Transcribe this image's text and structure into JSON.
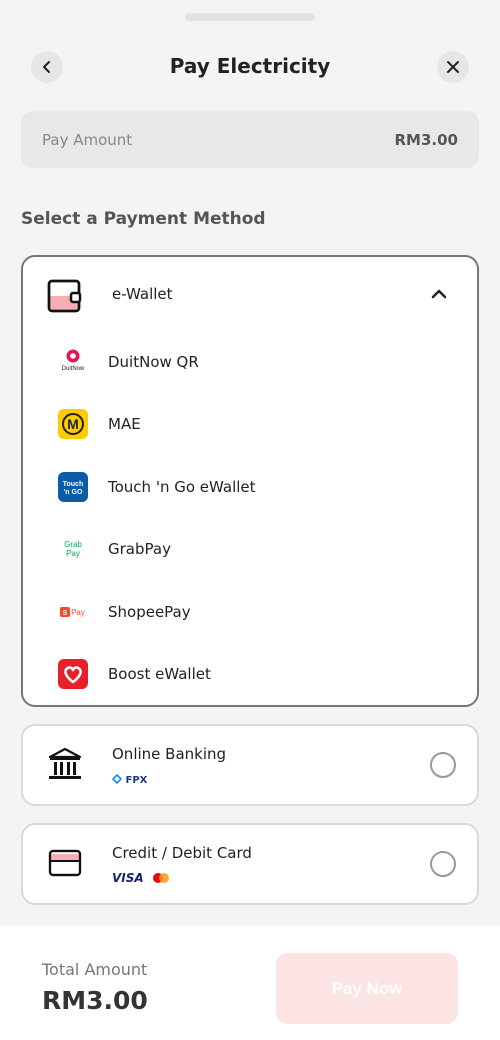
{
  "header": {
    "title": "Pay Electricity"
  },
  "pay_amount": {
    "label": "Pay Amount",
    "value": "RM3.00"
  },
  "section_title": "Select a Payment Method",
  "ewallet": {
    "label": "e-Wallet",
    "items": [
      {
        "name": "DuitNow QR",
        "logo_text": "DuitNow"
      },
      {
        "name": "MAE",
        "logo_text": "M"
      },
      {
        "name": "Touch 'n Go eWallet",
        "logo_text": "Touch 'n GO"
      },
      {
        "name": "GrabPay",
        "logo_text": "Grab Pay"
      },
      {
        "name": "ShopeePay",
        "logo_text": "S Pay"
      },
      {
        "name": "Boost eWallet",
        "logo_text": ""
      }
    ]
  },
  "online_banking": {
    "label": "Online Banking",
    "sub": "FPX"
  },
  "credit_card": {
    "label": "Credit / Debit Card",
    "sub": "VISA"
  },
  "footer": {
    "total_label": "Total Amount",
    "total_value": "RM3.00",
    "pay_button": "Pay Now"
  },
  "colors": {
    "accent": "#e8505b",
    "disabled_button": "#fde4e4"
  }
}
